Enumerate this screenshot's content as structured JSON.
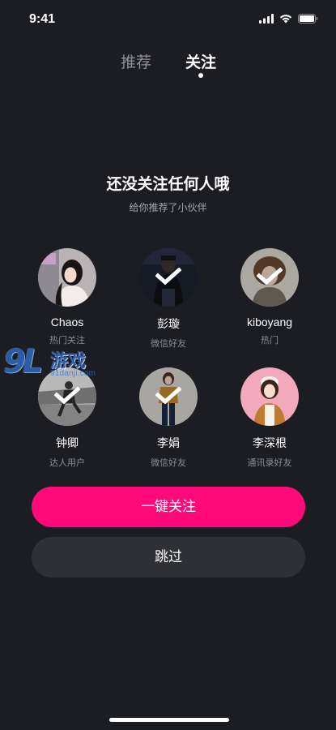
{
  "status_bar": {
    "time": "9:41",
    "icons": [
      "signal-icon",
      "wifi-icon",
      "battery-icon"
    ]
  },
  "tabs": [
    {
      "label": "推荐",
      "active": false
    },
    {
      "label": "关注",
      "active": true
    }
  ],
  "empty_state": {
    "title": "还没关注任何人哦",
    "subtitle": "给你推荐了小伙伴"
  },
  "recommendations": [
    {
      "name": "Chaos",
      "source": "热门关注",
      "selected": false
    },
    {
      "name": "彭璇",
      "source": "微信好友",
      "selected": true
    },
    {
      "name": "kiboyang",
      "source": "热门",
      "selected": true
    },
    {
      "name": "钟卿",
      "source": "达人用户",
      "selected": true
    },
    {
      "name": "李娟",
      "source": "微信好友",
      "selected": true
    },
    {
      "name": "李深根",
      "source": "通讯录好友",
      "selected": false
    }
  ],
  "watermark": {
    "number": "9L",
    "brand": "游戏",
    "url": "91danji.com"
  },
  "actions": {
    "follow_all": "一键关注",
    "skip": "跳过"
  },
  "colors": {
    "background": "#1c1d22",
    "accent": "#ff0a78",
    "secondary_button": "#2f3036"
  }
}
